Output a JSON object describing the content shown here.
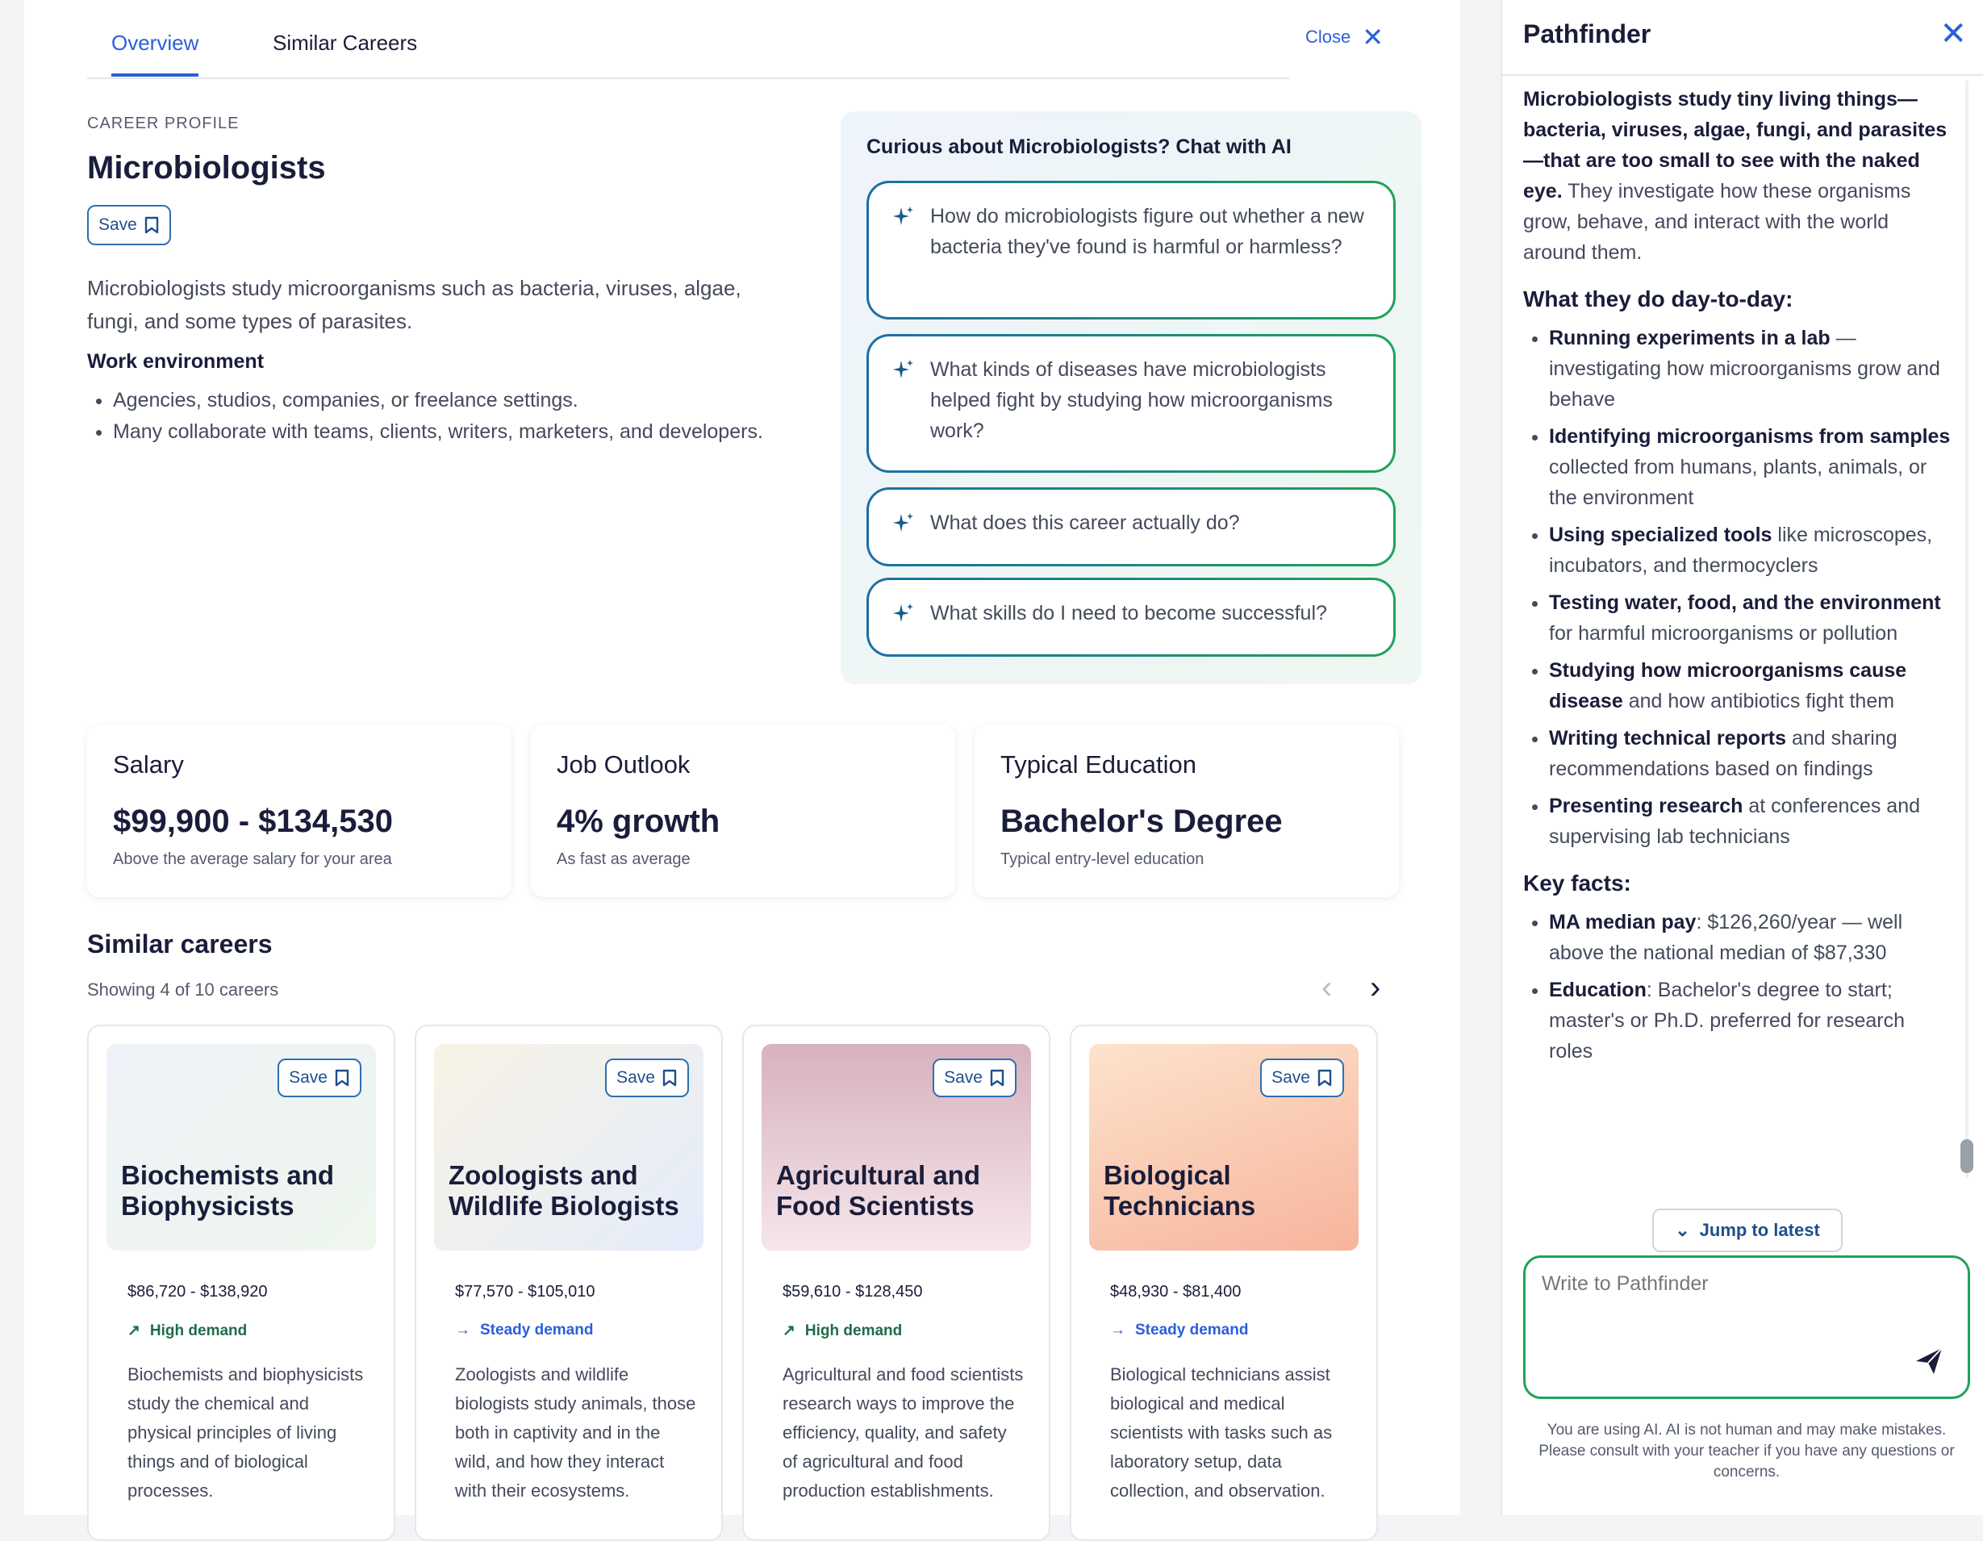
{
  "tabs": {
    "overview": "Overview",
    "similar": "Similar Careers"
  },
  "close_label": "Close",
  "profile": {
    "eyebrow": "CAREER PROFILE",
    "title": "Microbiologists",
    "save_label": "Save",
    "description": "Microbiologists study microorganisms such as bacteria, viruses, algae, fungi, and some types of parasites.",
    "work_heading": "Work environment",
    "work_items": [
      "Agencies, studios, companies, or freelance settings.",
      "Many collaborate with teams, clients, writers, marketers, and developers."
    ]
  },
  "chat_panel": {
    "title": "Curious about Microbiologists? Chat with AI",
    "suggestions": [
      "How do microbiologists figure out whether a new bacteria they've found is harmful or harmless?",
      "What kinds of diseases have microbiologists helped fight by studying how microorganisms work?",
      "What does this career actually do?",
      "What skills do I need to become successful?"
    ]
  },
  "stats": [
    {
      "label": "Salary",
      "value": "$99,900 - $134,530",
      "sub": "Above the average salary for your area"
    },
    {
      "label": "Job Outlook",
      "value": "4% growth",
      "sub": "As fast as average"
    },
    {
      "label": "Typical Education",
      "value": "Bachelor's Degree",
      "sub": "Typical entry-level education"
    }
  ],
  "similar": {
    "title": "Similar careers",
    "showing": "Showing 4 of 10 careers",
    "cards": [
      {
        "name": "Biochemists and Biophysicists",
        "salary": "$86,720 - $138,920",
        "demand": "High demand",
        "desc": "Biochemists and biophysicists study the chemical and physical principles of living things and of biological processes."
      },
      {
        "name": "Zoologists and Wildlife Biologists",
        "salary": "$77,570 - $105,010",
        "demand": "Steady demand",
        "desc": "Zoologists and wildlife biologists study animals, those both in captivity and in the wild, and how they interact with their ecosystems."
      },
      {
        "name": "Agricultural and Food Scientists",
        "salary": "$59,610 - $128,450",
        "demand": "High demand",
        "desc": "Agricultural and food scientists research ways to improve the efficiency, quality, and safety of agricultural and food production establishments."
      },
      {
        "name": "Biological Technicians",
        "salary": "$48,930 - $81,400",
        "demand": "Steady demand",
        "desc": "Biological technicians assist biological and medical scientists with tasks such as laboratory setup, data collection, and observation."
      }
    ]
  },
  "pathfinder": {
    "title": "Pathfinder",
    "intro_bold": "Microbiologists study tiny living things—bacteria, viruses, algae, fungi, and parasites—that are too small to see with the naked eye.",
    "intro_rest": " They investigate how these organisms grow, behave, and interact with the world around them.",
    "day_heading": "What they do day-to-day:",
    "day_items": [
      {
        "b": "Running experiments in a lab",
        "t": " — investigating how microorganisms grow and behave"
      },
      {
        "b": "Identifying microorganisms from samples",
        "t": " collected from humans, plants, animals, or the environment"
      },
      {
        "b": "Using specialized tools",
        "t": " like microscopes, incubators, and thermocyclers"
      },
      {
        "b": "Testing water, food, and the environment",
        "t": " for harmful microorganisms or pollution"
      },
      {
        "b": "Studying how microorganisms cause disease",
        "t": " and how antibiotics fight them"
      },
      {
        "b": "Writing technical reports",
        "t": " and sharing recommendations based on findings"
      },
      {
        "b": "Presenting research",
        "t": " at conferences and supervising lab technicians"
      }
    ],
    "facts_heading": "Key facts:",
    "facts_items": [
      {
        "b": "MA median pay",
        "t": ": $126,260/year — well above the national median of $87,330"
      },
      {
        "b": "Education",
        "t": ": Bachelor's degree to start; master's or Ph.D. preferred for research roles"
      }
    ],
    "jump_label": "Jump to latest",
    "input_placeholder": "Write to Pathfinder",
    "disclaimer": "You are using AI. AI is not human and may make mistakes. Please consult with your teacher if you have any questions or concerns."
  },
  "colors": {
    "accent": "#2b5fd9",
    "high_demand": "#1f6b4a",
    "steady_demand": "#2b5fd9",
    "green_border": "#1ea35a"
  }
}
